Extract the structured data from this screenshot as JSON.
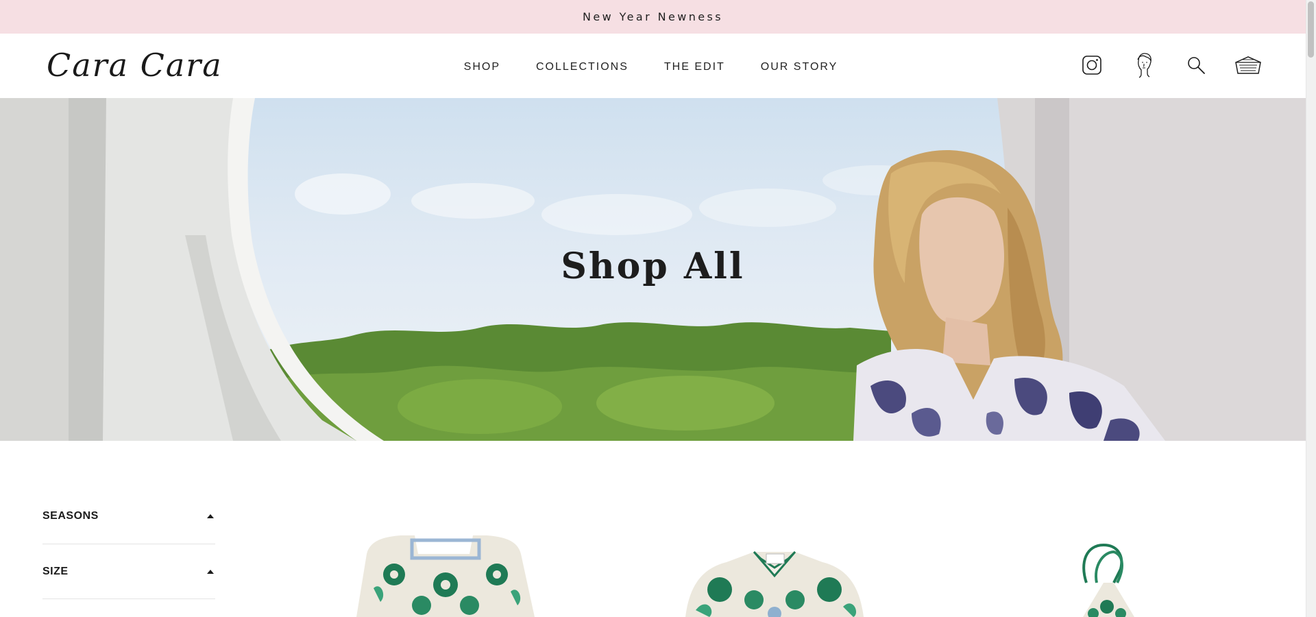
{
  "announcement": {
    "text": "New Year Newness"
  },
  "header": {
    "logo": "Cara Cara",
    "nav": [
      "SHOP",
      "COLLECTIONS",
      "THE EDIT",
      "OUR STORY"
    ],
    "icons": [
      "instagram-icon",
      "account-icon",
      "search-icon",
      "cart-icon"
    ]
  },
  "hero": {
    "title": "Shop All"
  },
  "filters": [
    {
      "label": "SEASONS",
      "state": "expanded"
    },
    {
      "label": "SIZE",
      "state": "expanded"
    }
  ],
  "colors": {
    "announcement_bg": "#f6dfe3",
    "text": "#1c1c1c",
    "print_green": "#1f7a55"
  }
}
